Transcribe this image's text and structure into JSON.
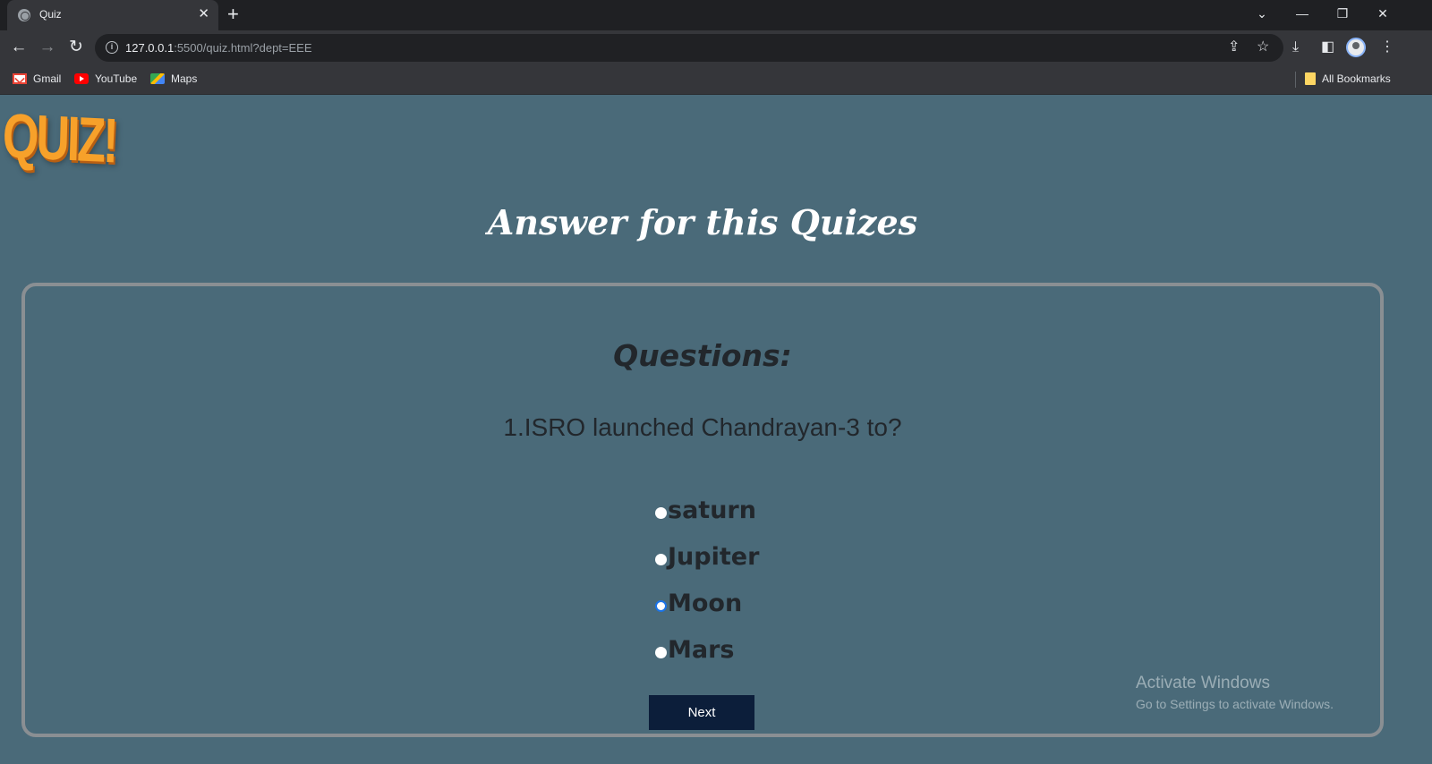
{
  "browser": {
    "tab_title": "Quiz",
    "tab_close": "✕",
    "new_tab": "+",
    "url_host": "127.0.0.1",
    "url_rest": ":5500/quiz.html?dept=EEE",
    "bookmarks": [
      {
        "label": "Gmail",
        "icon": "gmail-icon"
      },
      {
        "label": "YouTube",
        "icon": "youtube-icon"
      },
      {
        "label": "Maps",
        "icon": "maps-icon"
      }
    ],
    "all_bookmarks": "All Bookmarks"
  },
  "page": {
    "logo_text": "QUIZ!",
    "heading": "Answer for this Quizes",
    "questions_label": "Questions:",
    "question": "1.ISRO launched Chandrayan-3 to?",
    "options": [
      {
        "label": "saturn",
        "checked": false
      },
      {
        "label": "Jupiter",
        "checked": false
      },
      {
        "label": "Moon",
        "checked": true
      },
      {
        "label": "Mars",
        "checked": false
      }
    ],
    "next_label": "Next"
  },
  "watermark": {
    "title": "Activate Windows",
    "subtitle": "Go to Settings to activate Windows."
  },
  "colors": {
    "page_bg": "#4a6a79",
    "logo": "#f7a12a",
    "next_button": "#0c1e3a",
    "radio_checked": "#1a73e8"
  }
}
